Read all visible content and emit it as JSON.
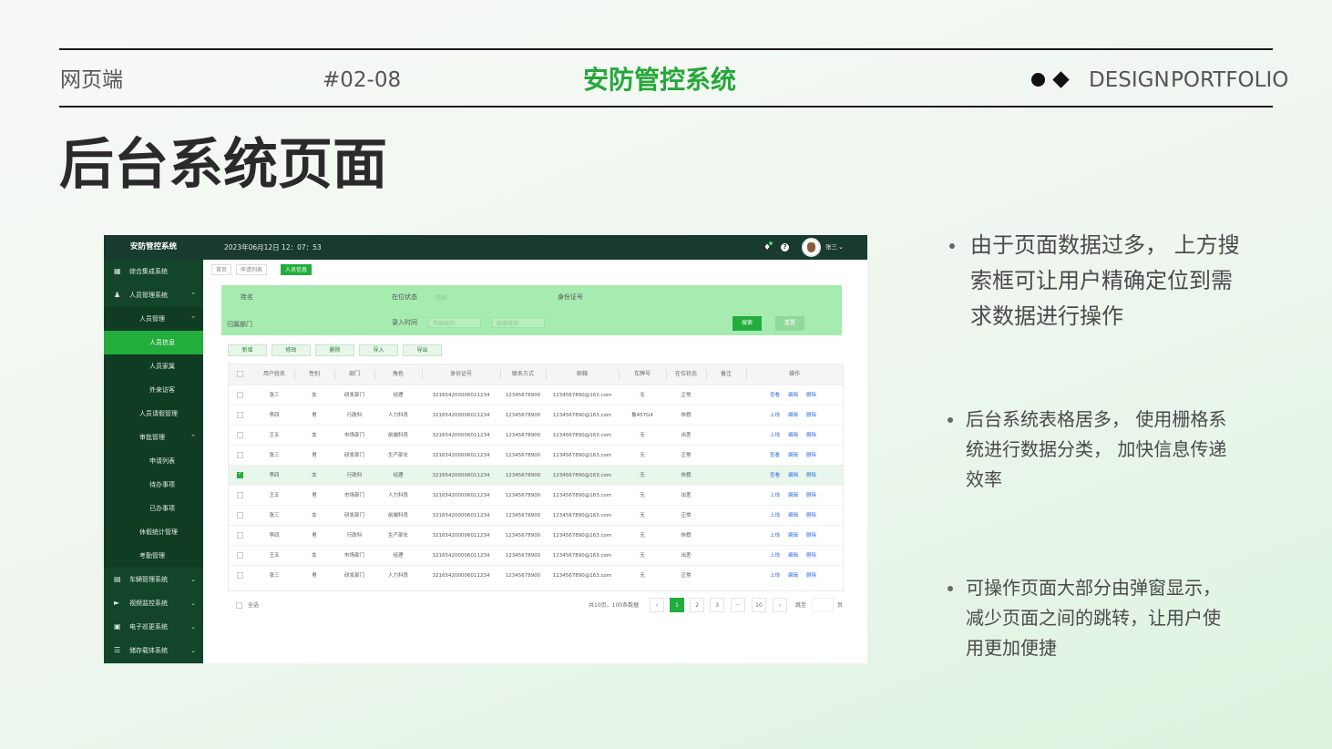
{
  "header": {
    "category": "网页端",
    "code": "#02-08",
    "title": "安防管控系统",
    "portfolio_1": "DESIGN",
    "portfolio_2": "PORTFOLIO"
  },
  "page_heading": "后台系统页面",
  "app": {
    "logo": "安防管控系统",
    "datetime": "2023年06月12日 12：07：53",
    "user": "张三",
    "sidebar": [
      {
        "label": "综合集成系统",
        "icon": "grid-icon"
      },
      {
        "label": "人员管理系统",
        "icon": "user-icon"
      },
      {
        "label": "人员管理"
      },
      {
        "label": "人员信息"
      },
      {
        "label": "人员家属"
      },
      {
        "label": "外来访客"
      },
      {
        "label": "人员请假管理"
      },
      {
        "label": "审批管理"
      },
      {
        "label": "申请列表"
      },
      {
        "label": "待办事项"
      },
      {
        "label": "已办事项"
      },
      {
        "label": "休假统计管理"
      },
      {
        "label": "考勤管理"
      },
      {
        "label": "车辆管理系统",
        "icon": "car-icon"
      },
      {
        "label": "视频监控系统",
        "icon": "camera-icon"
      },
      {
        "label": "电子巡更系统",
        "icon": "patrol-icon"
      },
      {
        "label": "储存载体系统",
        "icon": "storage-icon"
      }
    ],
    "breadcrumbs": [
      "首页",
      "申请列表",
      "人员信息"
    ],
    "search": {
      "name_label": "姓名",
      "status_label": "在位状态",
      "status_placeholder": "空闲",
      "id_label": "身份证号",
      "dept_label": "归属部门",
      "time_label": "录入时间",
      "start_placeholder": "开始时间",
      "end_placeholder": "结束时间",
      "search_btn": "搜索",
      "reset_btn": "重置"
    },
    "toolbar": [
      "新增",
      "修改",
      "删除",
      "导入",
      "导出"
    ],
    "columns": [
      "用户姓名",
      "性别",
      "部门",
      "角色",
      "身份证号",
      "联系方式",
      "邮箱",
      "车牌号",
      "在位状态",
      "备注",
      "操作"
    ],
    "rows": [
      {
        "name": "张三",
        "gender": "女",
        "dept": "研发部门",
        "role": "经理",
        "id": "321654200006011234",
        "phone": "12345678900",
        "email": "1234567890@163.com",
        "plate": "无",
        "status": "正常",
        "op1": "查看",
        "op2": "编辑",
        "op3": "删除"
      },
      {
        "name": "李四",
        "gender": "男",
        "dept": "行政科",
        "role": "人力科员",
        "id": "321654200006011234",
        "phone": "12345678900",
        "email": "1234567890@163.com",
        "plate": "鲁457G4",
        "status": "休假",
        "op1": "上线",
        "op2": "编辑",
        "op3": "删除"
      },
      {
        "name": "王五",
        "gender": "女",
        "dept": "市场部门",
        "role": "前端科员",
        "id": "321654200006011234",
        "phone": "12345678900",
        "email": "1234567890@163.com",
        "plate": "无",
        "status": "出差",
        "op1": "上线",
        "op2": "编辑",
        "op3": "删除"
      },
      {
        "name": "张三",
        "gender": "男",
        "dept": "研发部门",
        "role": "生产部长",
        "id": "321654200006011234",
        "phone": "12345678900",
        "email": "1234567890@163.com",
        "plate": "无",
        "status": "正常",
        "op1": "查看",
        "op2": "编辑",
        "op3": "删除"
      },
      {
        "name": "李四",
        "gender": "女",
        "dept": "行政科",
        "role": "经理",
        "id": "321654200006011234",
        "phone": "12345678900",
        "email": "1234567890@163.com",
        "plate": "无",
        "status": "休假",
        "op1": "查看",
        "op2": "编辑",
        "op3": "删除"
      },
      {
        "name": "王五",
        "gender": "男",
        "dept": "市场部门",
        "role": "人力科员",
        "id": "321654200006011234",
        "phone": "12345678900",
        "email": "1234567890@163.com",
        "plate": "无",
        "status": "出差",
        "op1": "上线",
        "op2": "编辑",
        "op3": "删除"
      },
      {
        "name": "张三",
        "gender": "女",
        "dept": "研发部门",
        "role": "前端科员",
        "id": "321654200006011234",
        "phone": "12345678900",
        "email": "1234567890@163.com",
        "plate": "无",
        "status": "正常",
        "op1": "上线",
        "op2": "编辑",
        "op3": "删除"
      },
      {
        "name": "李四",
        "gender": "男",
        "dept": "行政科",
        "role": "生产部长",
        "id": "321654200006011234",
        "phone": "12345678900",
        "email": "1234567890@163.com",
        "plate": "无",
        "status": "休假",
        "op1": "上线",
        "op2": "编辑",
        "op3": "删除"
      },
      {
        "name": "王五",
        "gender": "女",
        "dept": "市场部门",
        "role": "经理",
        "id": "321654200006011234",
        "phone": "12345678900",
        "email": "1234567890@163.com",
        "plate": "无",
        "status": "出差",
        "op1": "上线",
        "op2": "编辑",
        "op3": "删除"
      },
      {
        "name": "张三",
        "gender": "男",
        "dept": "研发部门",
        "role": "人力科员",
        "id": "321654200006011234",
        "phone": "12345678900",
        "email": "1234567890@163.com",
        "plate": "无",
        "status": "正常",
        "op1": "上线",
        "op2": "编辑",
        "op3": "删除"
      }
    ],
    "selected_row": 4,
    "select_all": "全选",
    "pagination": {
      "total": "共10页，100条数据",
      "pages": [
        "1",
        "2",
        "3",
        "···",
        "10"
      ],
      "current": "1",
      "prev": "‹",
      "next": "›",
      "goto_label": "跳至",
      "page_unit": "页"
    }
  },
  "notes": [
    [
      "由于页面数据过多， 上方搜",
      "索框可让用户精确定位到需",
      "求数据进行操作"
    ],
    [
      "后台系统表格居多， 使用栅格系",
      "统进行数据分类， 加快信息传递",
      "效率"
    ],
    [
      "可操作页面大部分由弹窗显示，",
      "减少页面之间的跳转，让用户使",
      "用更加便捷"
    ]
  ],
  "colors": {
    "accent": "#23ad3c",
    "sidebar": "#12452a",
    "topbar": "#193a2e",
    "search_panel": "#a6ecb0"
  }
}
